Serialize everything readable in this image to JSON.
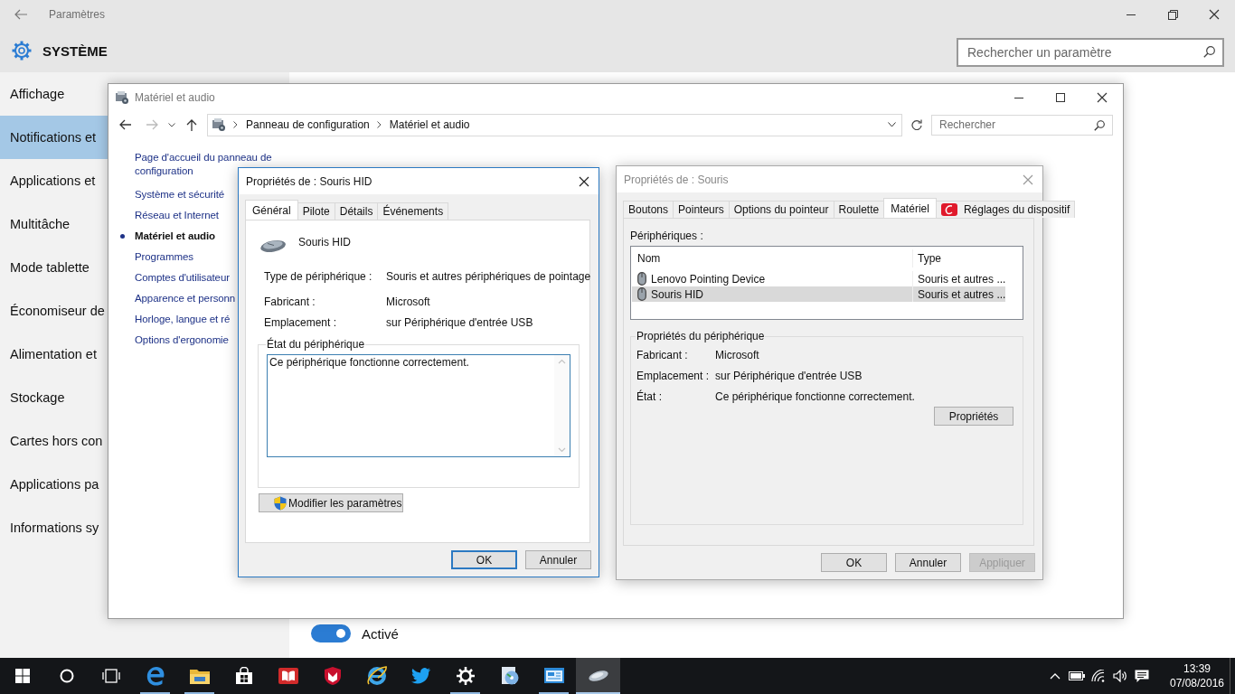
{
  "settings": {
    "title": "Paramètres",
    "section": "SYSTÈME",
    "search": {
      "placeholder": "Rechercher un paramètre"
    },
    "sidebar": {
      "items": [
        {
          "label": "Affichage",
          "selected": false
        },
        {
          "label": "Notifications et",
          "selected": true
        },
        {
          "label": "Applications et",
          "selected": false
        },
        {
          "label": "Multitâche",
          "selected": false
        },
        {
          "label": "Mode tablette",
          "selected": false
        },
        {
          "label": "Économiseur de",
          "selected": false
        },
        {
          "label": "Alimentation et",
          "selected": false
        },
        {
          "label": "Stockage",
          "selected": false
        },
        {
          "label": "Cartes hors con",
          "selected": false
        },
        {
          "label": "Applications pa",
          "selected": false
        },
        {
          "label": "Informations sy",
          "selected": false
        }
      ]
    },
    "toggle": {
      "on": true,
      "label": "Activé"
    }
  },
  "control_panel": {
    "title": "Matériel et audio",
    "breadcrumb": [
      "Panneau de configuration",
      "Matériel et audio"
    ],
    "search": {
      "placeholder": "Rechercher"
    },
    "nav": [
      {
        "label": "Page d'accueil du panneau de configuration",
        "current": false
      },
      {
        "label": "Système et sécurité",
        "current": false
      },
      {
        "label": "Réseau et Internet",
        "current": false
      },
      {
        "label": "Matériel et audio",
        "current": true
      },
      {
        "label": "Programmes",
        "current": false
      },
      {
        "label": "Comptes d'utilisateur",
        "current": false
      },
      {
        "label": "Apparence et personn",
        "current": false
      },
      {
        "label": "Horloge, langue et ré",
        "current": false
      },
      {
        "label": "Options d'ergonomie",
        "current": false
      }
    ]
  },
  "hid_dialog": {
    "title": "Propriétés de : Souris HID",
    "active": true,
    "tabs": [
      {
        "label": "Général",
        "selected": true
      },
      {
        "label": "Pilote",
        "selected": false
      },
      {
        "label": "Détails",
        "selected": false
      },
      {
        "label": "Événements",
        "selected": false
      }
    ],
    "device_name": "Souris HID",
    "properties": [
      {
        "label": "Type de périphérique :",
        "value": "Souris et autres périphériques de pointage"
      },
      {
        "label": "Fabricant :",
        "value": "Microsoft"
      },
      {
        "label": "Emplacement :",
        "value": "sur Périphérique d'entrée USB"
      }
    ],
    "status_group": "État du périphérique",
    "status_text": "Ce périphérique fonctionne correctement.",
    "change_button": "Modifier les paramètres",
    "buttons": [
      {
        "label": "OK",
        "default": true,
        "disabled": false
      },
      {
        "label": "Annuler",
        "default": false,
        "disabled": false
      }
    ]
  },
  "mouse_dialog": {
    "title": "Propriétés de : Souris",
    "active": false,
    "tabs": [
      {
        "label": "Boutons",
        "selected": false
      },
      {
        "label": "Pointeurs",
        "selected": false
      },
      {
        "label": "Options du pointeur",
        "selected": false
      },
      {
        "label": "Roulette",
        "selected": false
      },
      {
        "label": "Matériel",
        "selected": true
      },
      {
        "label": "Réglages du dispositif",
        "selected": false,
        "kind": "vendor"
      }
    ],
    "devices_label": "Périphériques :",
    "columns": [
      "Nom",
      "Type"
    ],
    "rows": [
      {
        "name": "Lenovo Pointing Device",
        "type": "Souris et autres ...",
        "selected": false
      },
      {
        "name": "Souris HID",
        "type": "Souris et autres ...",
        "selected": true
      }
    ],
    "properties_group": "Propriétés du périphérique",
    "properties": [
      {
        "label": "Fabricant :",
        "value": "Microsoft"
      },
      {
        "label": "Emplacement :",
        "value": "sur Périphérique d'entrée USB"
      },
      {
        "label": "État :",
        "value": "Ce périphérique fonctionne correctement."
      }
    ],
    "properties_button": "Propriétés",
    "buttons": [
      {
        "label": "OK",
        "default": false,
        "disabled": false
      },
      {
        "label": "Annuler",
        "default": false,
        "disabled": false
      },
      {
        "label": "Appliquer",
        "default": false,
        "disabled": true
      }
    ]
  },
  "taskbar": {
    "system_buttons": [
      {
        "kind": "start"
      },
      {
        "kind": "search"
      },
      {
        "kind": "task-view"
      }
    ],
    "apps": [
      {
        "kind": "edge",
        "running": true,
        "active": false
      },
      {
        "kind": "folder",
        "running": true,
        "active": false
      },
      {
        "kind": "store",
        "running": false,
        "active": false
      },
      {
        "kind": "book",
        "running": false,
        "active": false
      },
      {
        "kind": "shield",
        "running": false,
        "active": false
      },
      {
        "kind": "ie",
        "running": false,
        "active": false
      },
      {
        "kind": "bird",
        "running": false,
        "active": false
      },
      {
        "kind": "gear",
        "running": true,
        "active": false
      },
      {
        "kind": "disc",
        "running": false,
        "active": false
      },
      {
        "kind": "window",
        "running": true,
        "active": false
      },
      {
        "kind": "mouse",
        "running": true,
        "active": true
      }
    ],
    "tray": [
      {
        "kind": "caret"
      },
      {
        "kind": "battery"
      },
      {
        "kind": "wifi"
      },
      {
        "kind": "volume"
      },
      {
        "kind": "notifications"
      }
    ],
    "time": "13:39",
    "date": "07/08/2016"
  }
}
